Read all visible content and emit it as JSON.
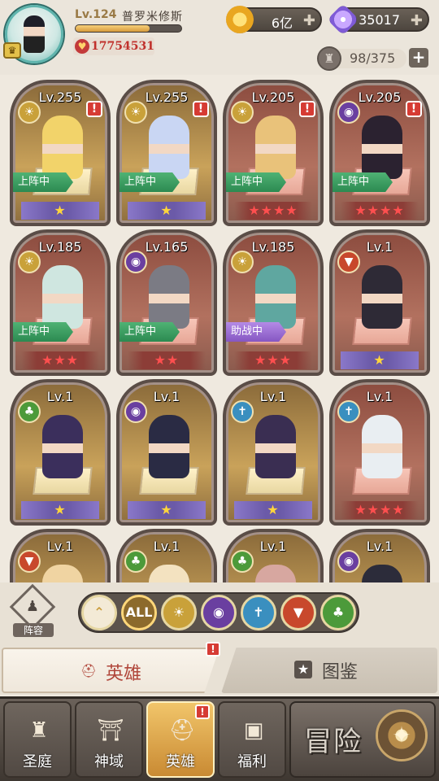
{
  "player": {
    "level": "Lv.124",
    "name": "普罗米修斯",
    "exp_fraction": 0.7,
    "power": "17754531"
  },
  "resources": {
    "gold": "6亿",
    "gems": "35017"
  },
  "hero_count": "98/375",
  "heroes": [
    {
      "level": "Lv.255",
      "faction": "light",
      "status": "上阵中",
      "stars": "★",
      "star_style": "gold",
      "alert": true
    },
    {
      "level": "Lv.255",
      "faction": "light",
      "status": "上阵中",
      "stars": "★",
      "star_style": "gold",
      "alert": true
    },
    {
      "level": "Lv.205",
      "faction": "light",
      "status": "上阵中",
      "stars": "★★★★",
      "star_style": "red",
      "alert": true
    },
    {
      "level": "Lv.205",
      "faction": "dark",
      "status": "上阵中",
      "stars": "★★★★",
      "star_style": "red",
      "alert": true
    },
    {
      "level": "Lv.185",
      "faction": "light",
      "status": "上阵中",
      "stars": "★★★",
      "star_style": "red",
      "alert": false
    },
    {
      "level": "Lv.165",
      "faction": "dark",
      "status": "上阵中",
      "stars": "★★",
      "star_style": "red",
      "alert": false
    },
    {
      "level": "Lv.185",
      "faction": "light",
      "status": "助战中",
      "stars": "★★★",
      "star_style": "red",
      "alert": false
    },
    {
      "level": "Lv.1",
      "faction": "fire",
      "status": "",
      "stars": "★",
      "star_style": "gold",
      "alert": false
    },
    {
      "level": "Lv.1",
      "faction": "nature",
      "status": "",
      "stars": "★",
      "star_style": "gold",
      "alert": false
    },
    {
      "level": "Lv.1",
      "faction": "dark",
      "status": "",
      "stars": "★",
      "star_style": "gold",
      "alert": false
    },
    {
      "level": "Lv.1",
      "faction": "water",
      "status": "",
      "stars": "★",
      "star_style": "gold",
      "alert": false
    },
    {
      "level": "Lv.1",
      "faction": "water",
      "status": "",
      "stars": "★★★★",
      "star_style": "red",
      "alert": false
    },
    {
      "level": "Lv.1",
      "faction": "fire",
      "status": "",
      "stars": "",
      "star_style": "gold",
      "alert": false
    },
    {
      "level": "Lv.1",
      "faction": "nature",
      "status": "",
      "stars": "",
      "star_style": "gold",
      "alert": false
    },
    {
      "level": "Lv.1",
      "faction": "nature",
      "status": "",
      "stars": "",
      "star_style": "gold",
      "alert": false
    },
    {
      "level": "Lv.1",
      "faction": "dark",
      "status": "",
      "stars": "",
      "star_style": "gold",
      "alert": false
    }
  ],
  "formation_label": "阵容",
  "filters": [
    "ALL"
  ],
  "tabs": {
    "hero": "英雄",
    "guide": "图鉴"
  },
  "nav": {
    "court": "圣庭",
    "domain": "神域",
    "hero": "英雄",
    "welfare": "福利",
    "adventure": "冒险"
  },
  "colors": {
    "light": "#c9a13a",
    "dark": "#6a3fa0",
    "fire": "#c8482c",
    "nature": "#4c9a3a",
    "water": "#3a8fbf"
  },
  "icons": {
    "light": "sun-wing-icon",
    "dark": "dark-eye-icon",
    "fire": "wolf-head-icon",
    "nature": "tree-icon",
    "water": "cross-shield-icon"
  }
}
